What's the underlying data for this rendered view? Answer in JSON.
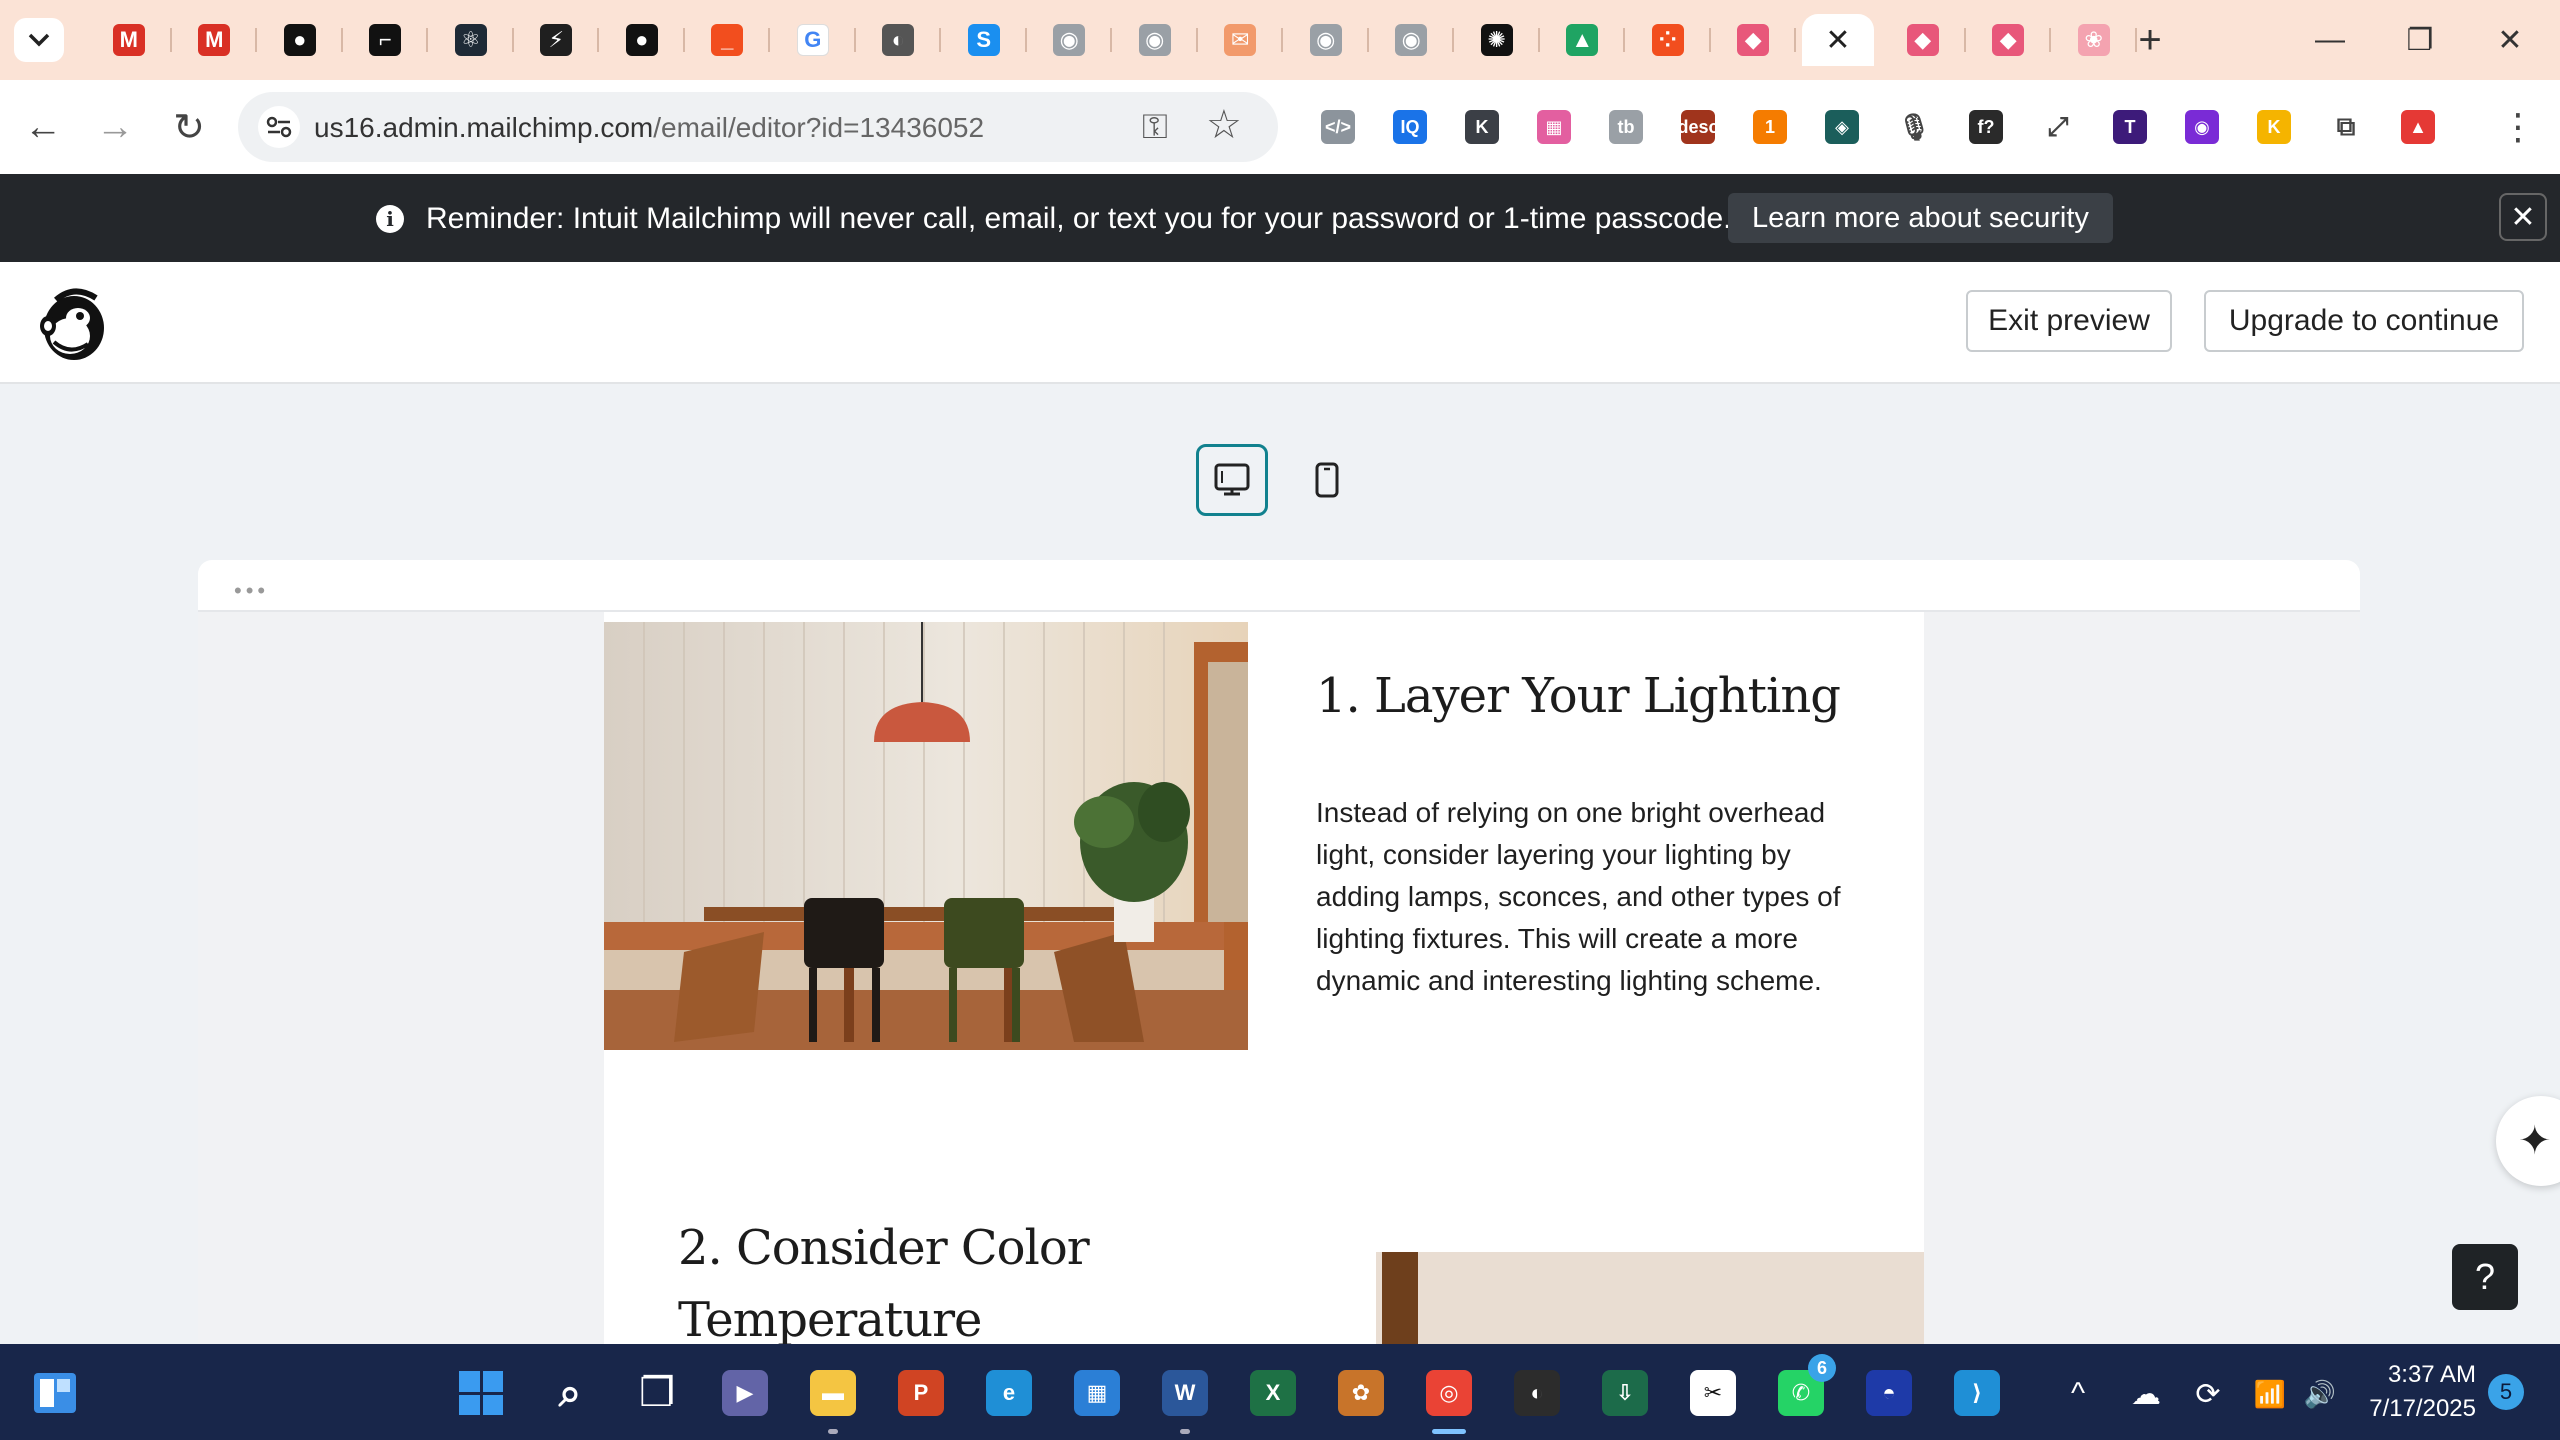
{
  "browser": {
    "tabs": [
      {
        "icon": "gmail-icon",
        "glyph": "M",
        "color": "#d93025"
      },
      {
        "icon": "gmail-icon",
        "glyph": "M",
        "color": "#d93025"
      },
      {
        "icon": "github-icon",
        "glyph": "●",
        "color": "#111111"
      },
      {
        "icon": "brush-icon",
        "glyph": "⌐",
        "color": "#111111"
      },
      {
        "icon": "react-icon",
        "glyph": "⚛",
        "color": "#1e2a36"
      },
      {
        "icon": "supabase-icon",
        "glyph": "⚡",
        "color": "#1f1f1f"
      },
      {
        "icon": "github-icon",
        "glyph": "●",
        "color": "#111111"
      },
      {
        "icon": "red-square-icon",
        "glyph": "_",
        "color": "#f24e1e"
      },
      {
        "icon": "google-icon",
        "glyph": "G",
        "color": "#ffffff"
      },
      {
        "icon": "globe-icon",
        "glyph": "◐",
        "color": "#555555"
      },
      {
        "icon": "skype-icon",
        "glyph": "S",
        "color": "#1a8ff0"
      },
      {
        "icon": "avatar-icon",
        "glyph": "◉",
        "color": "#9aa0a6"
      },
      {
        "icon": "avatar-icon",
        "glyph": "◉",
        "color": "#9aa0a6"
      },
      {
        "icon": "mail-icon",
        "glyph": "✉",
        "color": "#f29a6b"
      },
      {
        "icon": "avatar-icon",
        "glyph": "◉",
        "color": "#9aa0a6"
      },
      {
        "icon": "avatar-icon",
        "glyph": "◉",
        "color": "#9aa0a6"
      },
      {
        "icon": "openai-icon",
        "glyph": "✺",
        "color": "#111111"
      },
      {
        "icon": "drive-icon",
        "glyph": "▲",
        "color": "#1fa463"
      },
      {
        "icon": "figma-icon",
        "glyph": "⁘",
        "color": "#f24e1e"
      },
      {
        "icon": "app-icon",
        "glyph": "◆",
        "color": "#e8577a"
      },
      {
        "icon": "close-icon",
        "glyph": "✕",
        "color": "#ffffff",
        "active": true
      },
      {
        "icon": "app-icon",
        "glyph": "◆",
        "color": "#e8577a"
      },
      {
        "icon": "app-icon",
        "glyph": "◆",
        "color": "#e8577a"
      },
      {
        "icon": "brain-icon",
        "glyph": "❀",
        "color": "#f4a3b0"
      }
    ],
    "new_tab": "+",
    "window_controls": {
      "minimize": "—",
      "restore": "❐",
      "close": "✕"
    },
    "url_host": "us16.admin.mailchimp.com",
    "url_path": "/email/editor?id=13436052",
    "extensions": [
      {
        "icon": "code-extension-icon",
        "glyph": "</>",
        "color": "#8c949c"
      },
      {
        "icon": "iq-extension-icon",
        "glyph": "IQ",
        "color": "#1a73e8"
      },
      {
        "icon": "k-extension-icon",
        "glyph": "K",
        "color": "#3b3f46"
      },
      {
        "icon": "color-grid-extension-icon",
        "glyph": "▦",
        "color": "#e35fa0"
      },
      {
        "icon": "tb-extension-icon",
        "glyph": "tb",
        "color": "#9aa0a6"
      },
      {
        "icon": "desc-extension-icon",
        "glyph": "desc",
        "color": "#a0341c"
      },
      {
        "icon": "orange-extension-icon",
        "glyph": "1",
        "color": "#f57c00"
      },
      {
        "icon": "diamond-extension-icon",
        "glyph": "◈",
        "color": "#1b5e5b"
      },
      {
        "icon": "microphone-icon",
        "glyph": "🎙",
        "color": "#ffffff"
      },
      {
        "icon": "function-extension-icon",
        "glyph": "f?",
        "color": "#2a2a2a"
      },
      {
        "icon": "expand-icon",
        "glyph": "⤢",
        "color": "#ffffff"
      },
      {
        "icon": "t-extension-icon",
        "glyph": "T",
        "color": "#3d1b7a"
      },
      {
        "icon": "eye-extension-icon",
        "glyph": "◉",
        "color": "#7a2bd6"
      },
      {
        "icon": "k-yellow-extension-icon",
        "glyph": "K",
        "color": "#f5b400"
      },
      {
        "icon": "puzzle-icon",
        "glyph": "⧉",
        "color": "#ffffff"
      },
      {
        "icon": "profile-avatar-icon",
        "glyph": "▲",
        "color": "#e53935"
      }
    ]
  },
  "banner": {
    "text": "Reminder: Intuit Mailchimp will never call, email, or text you for your password or 1-time passcode.",
    "link_label": "Learn more about security"
  },
  "header": {
    "exit_preview_label": "Exit preview",
    "upgrade_label": "Upgrade to continue"
  },
  "preview": {
    "dots": "•••",
    "section1_title": "1. Layer Your Lighting",
    "section1_body": "Instead of relying on one bright overhead light, consider layering your lighting by adding lamps, sconces, and other types of lighting fixtures. This will create a more dynamic and interesting lighting scheme.",
    "section2_title": "2. Consider Color Temperature",
    "help_label": "?"
  },
  "taskbar": {
    "apps": [
      {
        "icon": "windows-start-icon",
        "glyph": "",
        "color": "#3a8ee6"
      },
      {
        "icon": "search-icon",
        "glyph": "⌕",
        "color": "transparent"
      },
      {
        "icon": "task-view-icon",
        "glyph": "❐",
        "color": "transparent"
      },
      {
        "icon": "meet-icon",
        "glyph": "▶",
        "color": "#6264a7"
      },
      {
        "icon": "file-explorer-icon",
        "glyph": "▬",
        "color": "#f4c542"
      },
      {
        "icon": "powerpoint-icon",
        "glyph": "P",
        "color": "#d04423"
      },
      {
        "icon": "edge-icon",
        "glyph": "e",
        "color": "#1f8fd6"
      },
      {
        "icon": "store-icon",
        "glyph": "▦",
        "color": "#2b7fd6"
      },
      {
        "icon": "word-icon",
        "glyph": "W",
        "color": "#2b579a"
      },
      {
        "icon": "excel-icon",
        "glyph": "X",
        "color": "#1e7145"
      },
      {
        "icon": "ananas-icon",
        "glyph": "✿",
        "color": "#c8742a"
      },
      {
        "icon": "chrome-icon",
        "glyph": "◎",
        "color": "#ea4335"
      },
      {
        "icon": "obs-icon",
        "glyph": "◐",
        "color": "#2c2c2c"
      },
      {
        "icon": "download-app-icon",
        "glyph": "⇩",
        "color": "#1c6b4a"
      },
      {
        "icon": "capcut-icon",
        "glyph": "✂",
        "color": "#ffffff"
      },
      {
        "icon": "whatsapp-icon",
        "glyph": "✆",
        "color": "#25d366"
      },
      {
        "icon": "helmet-icon",
        "glyph": "◓",
        "color": "#1e3aa8"
      },
      {
        "icon": "vscode-icon",
        "glyph": "⟩",
        "color": "#1f8fd6"
      }
    ],
    "whatsapp_badge": "6",
    "tray": {
      "chevron": "^",
      "cloud": "☁",
      "sync": "⟳",
      "wifi": "📶",
      "volume": "🔊"
    },
    "time": "3:37 AM",
    "date": "7/17/2025",
    "notifications": "5"
  }
}
